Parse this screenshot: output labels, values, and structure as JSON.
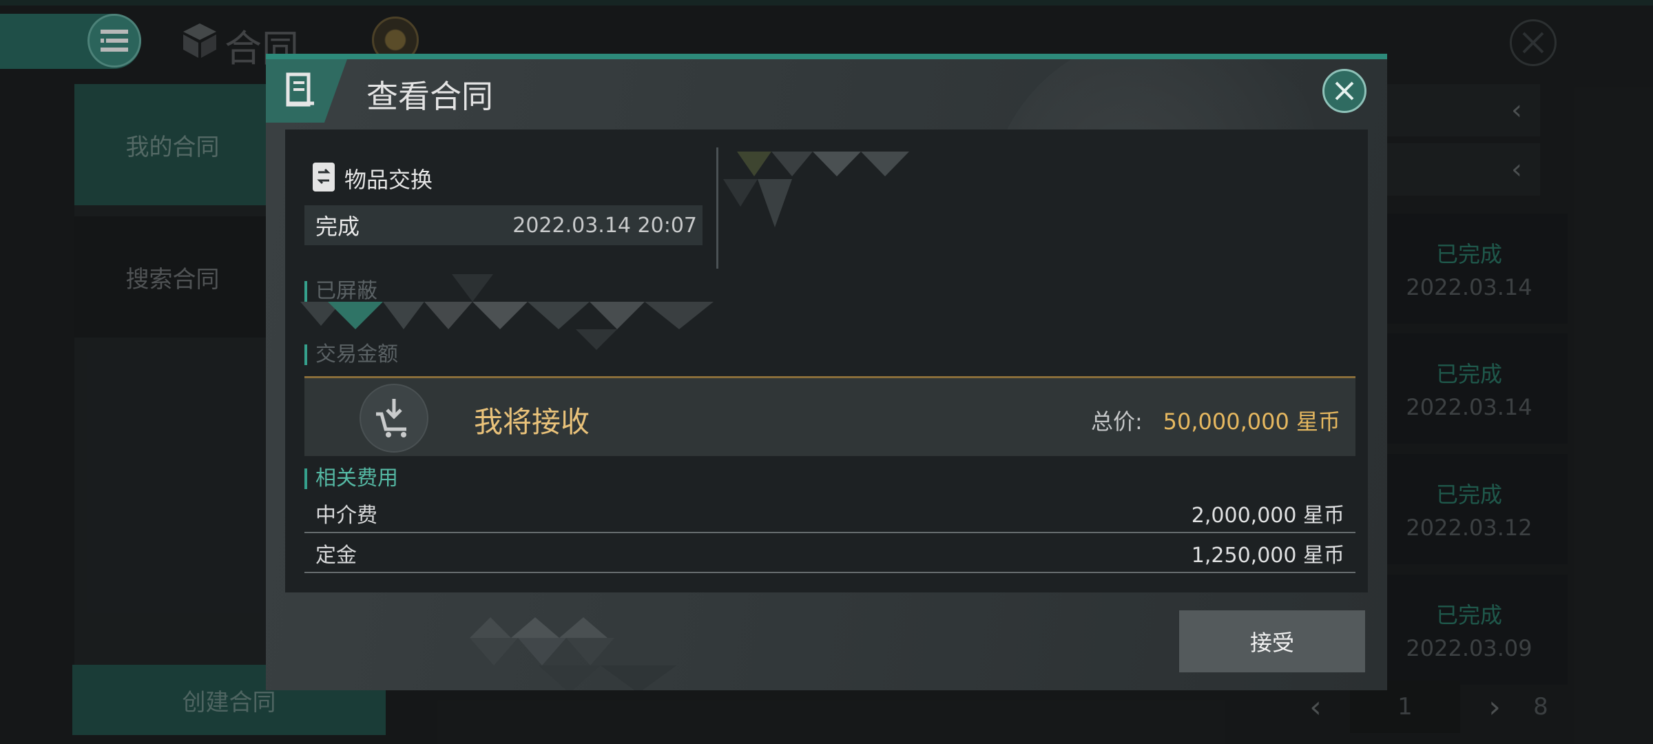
{
  "background": {
    "title": "合同",
    "sidebar": {
      "items": [
        {
          "label": "我的合同"
        },
        {
          "label": "搜索合同"
        }
      ],
      "create_label": "创建合同"
    },
    "list": {
      "filter_chevron_1": "‹",
      "filter_chevron_2": "‹",
      "rows": [
        {
          "status": "已完成",
          "date": "2022.03.14"
        },
        {
          "status": "已完成",
          "date": "2022.03.14"
        },
        {
          "status": "已完成",
          "date": "2022.03.12"
        },
        {
          "status": "已完成",
          "date": "2022.03.09"
        }
      ]
    },
    "pagination": {
      "prev": "‹",
      "page": "1",
      "next": "›",
      "total": "8"
    }
  },
  "modal": {
    "title": "查看合同",
    "contract_type": "物品交换",
    "status": "完成",
    "date": "2022.03.14 20:07",
    "section_items": "已屏蔽",
    "section_amount": "交易金额",
    "receive_label": "我将接收",
    "total_label": "总价:",
    "total_value": "50,000,000 星币",
    "fees_title": "相关费用",
    "fees": [
      {
        "name": "中介费",
        "value": "2,000,000 星币"
      },
      {
        "name": "定金",
        "value": "1,250,000 星币"
      }
    ],
    "accept_label": "接受"
  },
  "colors": {
    "accent_teal": "#2d8a7a",
    "status_green": "#2c7a69",
    "gold": "#e6b860"
  },
  "icons": [
    "menu-icon",
    "cube-icon",
    "orb-icon",
    "close-icon",
    "contract-icon",
    "exchange-icon",
    "download-cart-icon",
    "chevron-left-icon",
    "chevron-right-icon"
  ]
}
